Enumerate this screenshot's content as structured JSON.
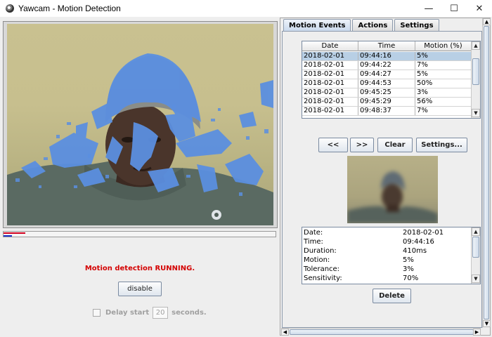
{
  "window": {
    "title": "Yawcam - Motion Detection",
    "minimize_glyph": "—",
    "maximize_glyph": "☐",
    "close_glyph": "✕"
  },
  "main": {
    "progress": {
      "red_level_percent": 8,
      "blue_level_percent": 3
    },
    "status_text": "Motion detection RUNNING.",
    "status_color": "#d40000",
    "disable_label": "disable",
    "delay": {
      "checked": false,
      "label_before": "Delay start",
      "value": "20",
      "label_after": "seconds."
    }
  },
  "tabs": [
    {
      "label": "Motion Events",
      "active": true
    },
    {
      "label": "Actions",
      "active": false
    },
    {
      "label": "Settings",
      "active": false
    }
  ],
  "events_table": {
    "columns": [
      "Date",
      "Time",
      "Motion (%)"
    ],
    "rows": [
      {
        "date": "2018-02-01",
        "time": "09:44:16",
        "motion": "5%",
        "selected": true
      },
      {
        "date": "2018-02-01",
        "time": "09:44:22",
        "motion": "7%"
      },
      {
        "date": "2018-02-01",
        "time": "09:44:27",
        "motion": "5%"
      },
      {
        "date": "2018-02-01",
        "time": "09:44:53",
        "motion": "50%"
      },
      {
        "date": "2018-02-01",
        "time": "09:45:25",
        "motion": "3%"
      },
      {
        "date": "2018-02-01",
        "time": "09:45:29",
        "motion": "56%"
      },
      {
        "date": "2018-02-01",
        "time": "09:48:37",
        "motion": "7%"
      }
    ]
  },
  "event_buttons": {
    "prev": "<<",
    "next": ">>",
    "clear": "Clear",
    "settings": "Settings..."
  },
  "details": [
    {
      "key": "Date:",
      "value": "2018-02-01"
    },
    {
      "key": "Time:",
      "value": "09:44:16"
    },
    {
      "key": "Duration:",
      "value": "410ms"
    },
    {
      "key": "Motion:",
      "value": "5%"
    },
    {
      "key": "Tolerance:",
      "value": "3%"
    },
    {
      "key": "Sensitivity:",
      "value": "70%"
    }
  ],
  "delete_label": "Delete",
  "icons": {
    "up_arrow": "▲",
    "down_arrow": "▼",
    "left_arrow": "◀",
    "right_arrow": "▶"
  },
  "colors": {
    "motion_overlay": "#5b8fe0",
    "selection": "#b8cfe5"
  }
}
